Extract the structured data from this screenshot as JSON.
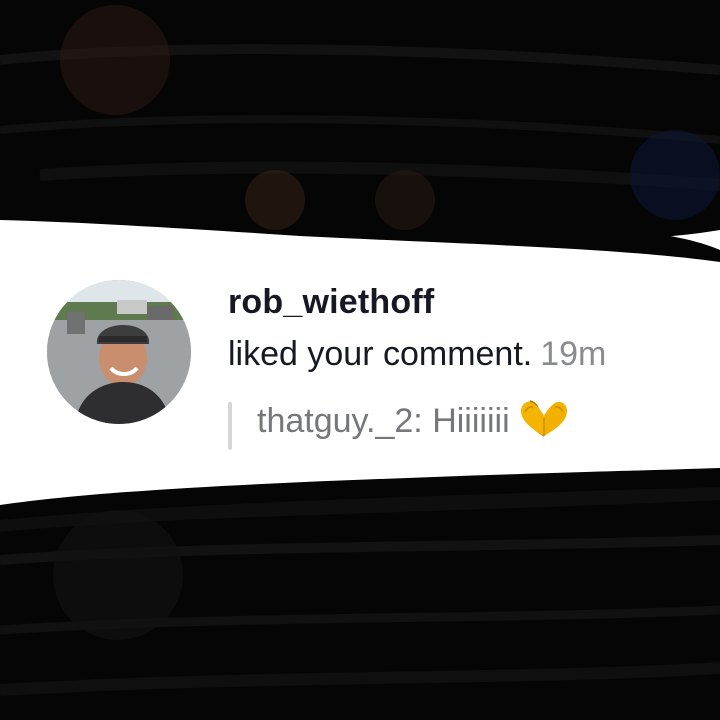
{
  "notification": {
    "username": "rob_wiethoff",
    "action": "liked your comment.",
    "time": "19m",
    "quoted_comment": {
      "author": "thatguy._2",
      "text": "Hiiiiiii",
      "emoji_icon": "heart-hands-icon"
    },
    "avatar_icon": "profile-avatar"
  },
  "colors": {
    "background": "#ffffff",
    "scribble": "#050505",
    "username": "#161823",
    "timestamp": "#8a8b91",
    "quote_text": "#76777d",
    "quote_bar": "#d6d6d8",
    "emoji": "#f4b400"
  }
}
